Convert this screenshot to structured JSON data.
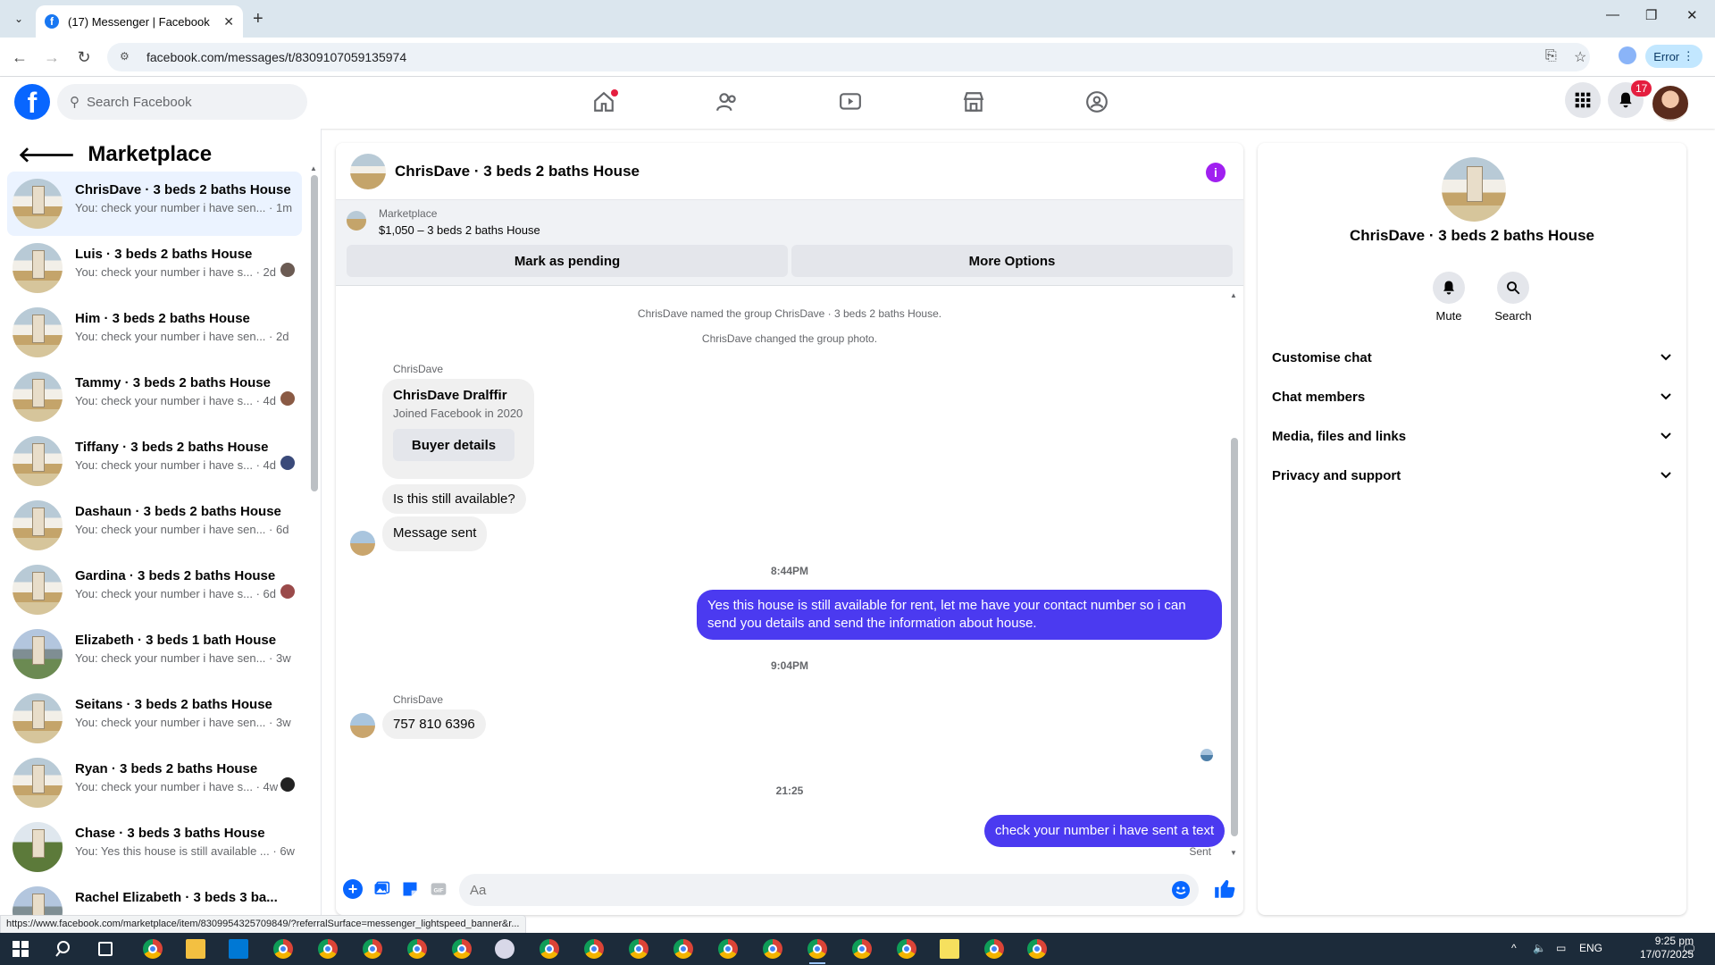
{
  "browser": {
    "tab_title": "(17) Messenger | Facebook",
    "url": "facebook.com/messages/t/8309107059135974",
    "profile_button": "Error",
    "status_url": "https://www.facebook.com/marketplace/item/8309954325709849/?referralSurface=messenger_lightspeed_banner&r..."
  },
  "header": {
    "search_placeholder": "Search Facebook",
    "notification_count": "17",
    "nav_icons": [
      "home-icon",
      "friends-icon",
      "video-icon",
      "marketplace-icon",
      "groups-icon"
    ]
  },
  "left": {
    "title": "Marketplace",
    "conversations": [
      {
        "name": "ChrisDave · 3 beds 2 baths House",
        "preview": "You: check your number i have sen... · 1m",
        "active": true
      },
      {
        "name": "Luis · 3 beds 2 baths House",
        "preview": "You: check your number i have s... · 2d"
      },
      {
        "name": "Him · 3 beds 2 baths House",
        "preview": "You: check your number i have sen... · 2d"
      },
      {
        "name": "Tammy · 3 beds 2 baths House",
        "preview": "You: check your number i have s... · 4d"
      },
      {
        "name": "Tiffany · 3 beds 2 baths House",
        "preview": "You: check your number i have s... · 4d"
      },
      {
        "name": "Dashaun · 3 beds 2 baths House",
        "preview": "You: check your number i have sen... · 6d"
      },
      {
        "name": "Gardina · 3 beds 2 baths House",
        "preview": "You: check your number i have s... · 6d"
      },
      {
        "name": "Elizabeth · 3 beds 1 bath House",
        "preview": "You: check your number i have sen... · 3w"
      },
      {
        "name": "Seitans · 3 beds 2 baths House",
        "preview": "You: check your number i have sen... · 3w"
      },
      {
        "name": "Ryan · 3 beds 2 baths House",
        "preview": "You: check your number i have s... · 4w"
      },
      {
        "name": "Chase · 3 beds 3 baths House",
        "preview": "You: Yes this house is still available ... · 6w"
      },
      {
        "name": "Rachel Elizabeth · 3 beds 3 ba...",
        "preview": ""
      }
    ]
  },
  "chat": {
    "title": "ChrisDave · 3 beds 2 baths House",
    "banner_label": "Marketplace",
    "banner_item": "$1,050 – 3 beds 2 baths House",
    "mark_pending": "Mark as pending",
    "more_options": "More Options",
    "sys1": "ChrisDave named the group ChrisDave · 3 beds 2 baths House.",
    "sys2": "ChrisDave changed the group photo.",
    "sender1": "ChrisDave",
    "card_name": "ChrisDave Dralffir",
    "card_sub": "Joined Facebook in 2020",
    "buyer_details": "Buyer details",
    "msg_in1": "Is this still available?",
    "msg_in2": "Message sent",
    "time1": "8:44PM",
    "msg_out1": "Yes this house is still available for rent, let me have your contact number so i can send you details and send the information about house.",
    "time2": "9:04PM",
    "sender2": "ChrisDave",
    "msg_in3": "757 810 6396",
    "time3": "21:25",
    "msg_out2": "check your number i have sent a text",
    "sent_label": "Sent",
    "composer_placeholder": "Aa"
  },
  "info": {
    "title": "ChrisDave · 3 beds 2 baths House",
    "mute": "Mute",
    "search": "Search",
    "sections": [
      "Customise chat",
      "Chat members",
      "Media, files and links",
      "Privacy and support"
    ]
  },
  "taskbar": {
    "language": "ENG",
    "time": "9:25 pm",
    "date": "17/07/2025"
  },
  "colors": {
    "accent": "#0866ff",
    "outgoing_bubble": "#4b3af0",
    "badge": "#e41e3f"
  }
}
